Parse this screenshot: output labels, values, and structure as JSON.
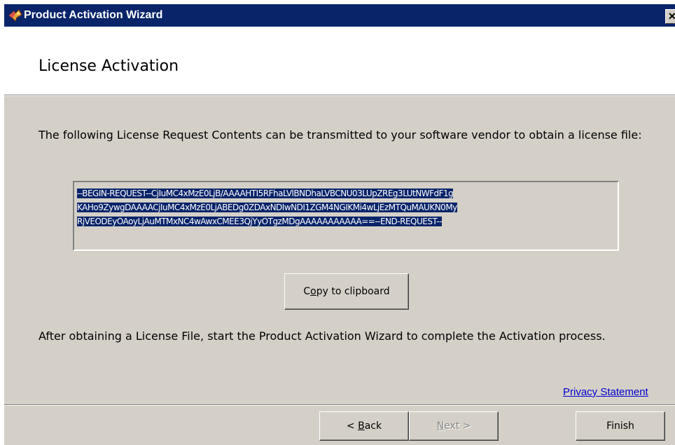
{
  "window": {
    "title": "Product Activation Wizard",
    "close_glyph": "✕",
    "title_icon": "wizard-icon",
    "title_bar_color": "#0a246a"
  },
  "header": {
    "title": "License Activation"
  },
  "body": {
    "intro_text": "The following License Request Contents can be transmitted to your software vendor to obtain a license file:",
    "request_lines": [
      "--BEGIN-REQUEST--CjIuMC4xMzE0LjB/AAAAHTI5RFhaLVlBNDhaLVBCNU03LUpZREg3LUtNWFdF1g",
      "KAHo9ZywgDAAAACjIuMC4xMzE0LjABEDg0ZDAxNDIwNDI1ZGM4NGIKMi4wLjEzMTQuMAUKN0My",
      "RjVEODEyOAoyLjAuMTMxNC4wAwxCMEE3QjYyOTgzMDgAAAAAAAAAAA==--END-REQUEST--"
    ],
    "copy_button": {
      "pre": "C",
      "mnemonic": "o",
      "post": "py to clipboard"
    },
    "after_text": "After obtaining a License File, start the Product Activation Wizard to complete the Activation process.",
    "privacy_link": "Privacy Statement",
    "link_color": "#0000cc",
    "selection_color": "#0a246a"
  },
  "footer": {
    "back_button": {
      "pre": "< ",
      "mnemonic": "B",
      "post": "ack"
    },
    "next_button": {
      "pre": "",
      "mnemonic": "N",
      "post": "ext >",
      "enabled": false
    },
    "finish_button": "Finish"
  }
}
